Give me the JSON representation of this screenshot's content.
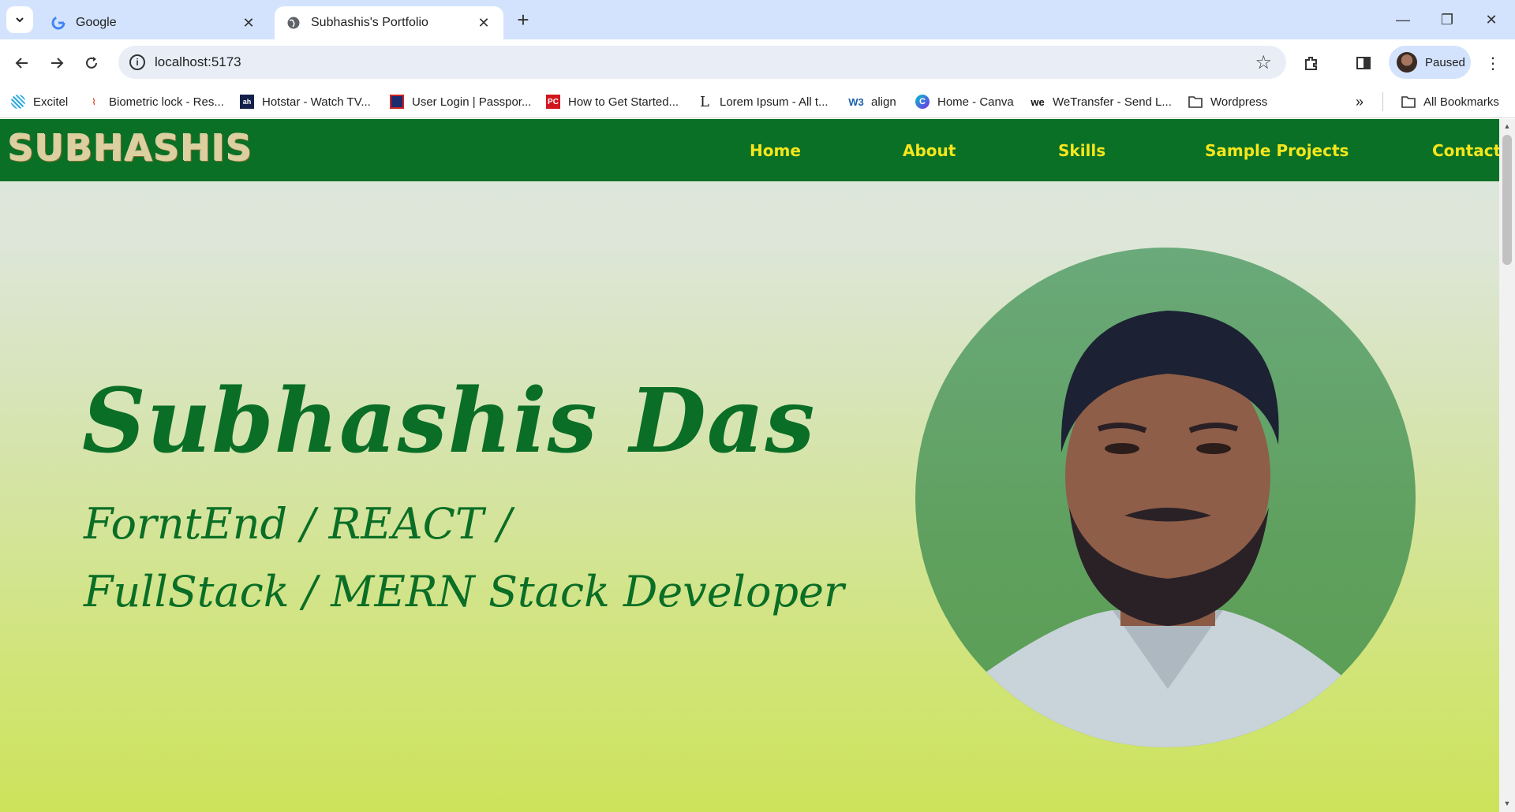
{
  "tabs": [
    {
      "title": "Google",
      "icon": "google-icon",
      "active": false
    },
    {
      "title": "Subhashis's Portfolio",
      "icon": "globe-icon",
      "active": true
    }
  ],
  "address_bar": {
    "url": "localhost:5173"
  },
  "profile": {
    "label": "Paused"
  },
  "bookmarks": [
    {
      "label": "Excitel",
      "icon": "excitel-icon"
    },
    {
      "label": "Biometric lock - Res...",
      "icon": "fingerprint-icon"
    },
    {
      "label": "Hotstar - Watch TV...",
      "icon": "hotstar-icon"
    },
    {
      "label": "User Login | Passpor...",
      "icon": "passport-icon"
    },
    {
      "label": "How to Get Started...",
      "icon": "pc-icon"
    },
    {
      "label": "Lorem Ipsum - All t...",
      "icon": "lorem-icon"
    },
    {
      "label": "align",
      "icon": "w3-icon"
    },
    {
      "label": "Home - Canva",
      "icon": "canva-icon"
    },
    {
      "label": "WeTransfer - Send L...",
      "icon": "wetransfer-icon"
    },
    {
      "label": "Wordpress",
      "icon": "folder-icon"
    }
  ],
  "all_bookmarks": "All Bookmarks",
  "site": {
    "logo": "SUBHASHIS",
    "nav": [
      "Home",
      "About",
      "Skills",
      "Sample Projects",
      "Contact"
    ],
    "hero": {
      "name": "Subhashis Das",
      "role_line1": "ForntEnd / REACT /",
      "role_line2": "FullStack / MERN Stack Developer"
    }
  },
  "colors": {
    "nav_bg": "#0a7026",
    "nav_link": "#f5e61c",
    "hero_text": "#0a6e26"
  }
}
